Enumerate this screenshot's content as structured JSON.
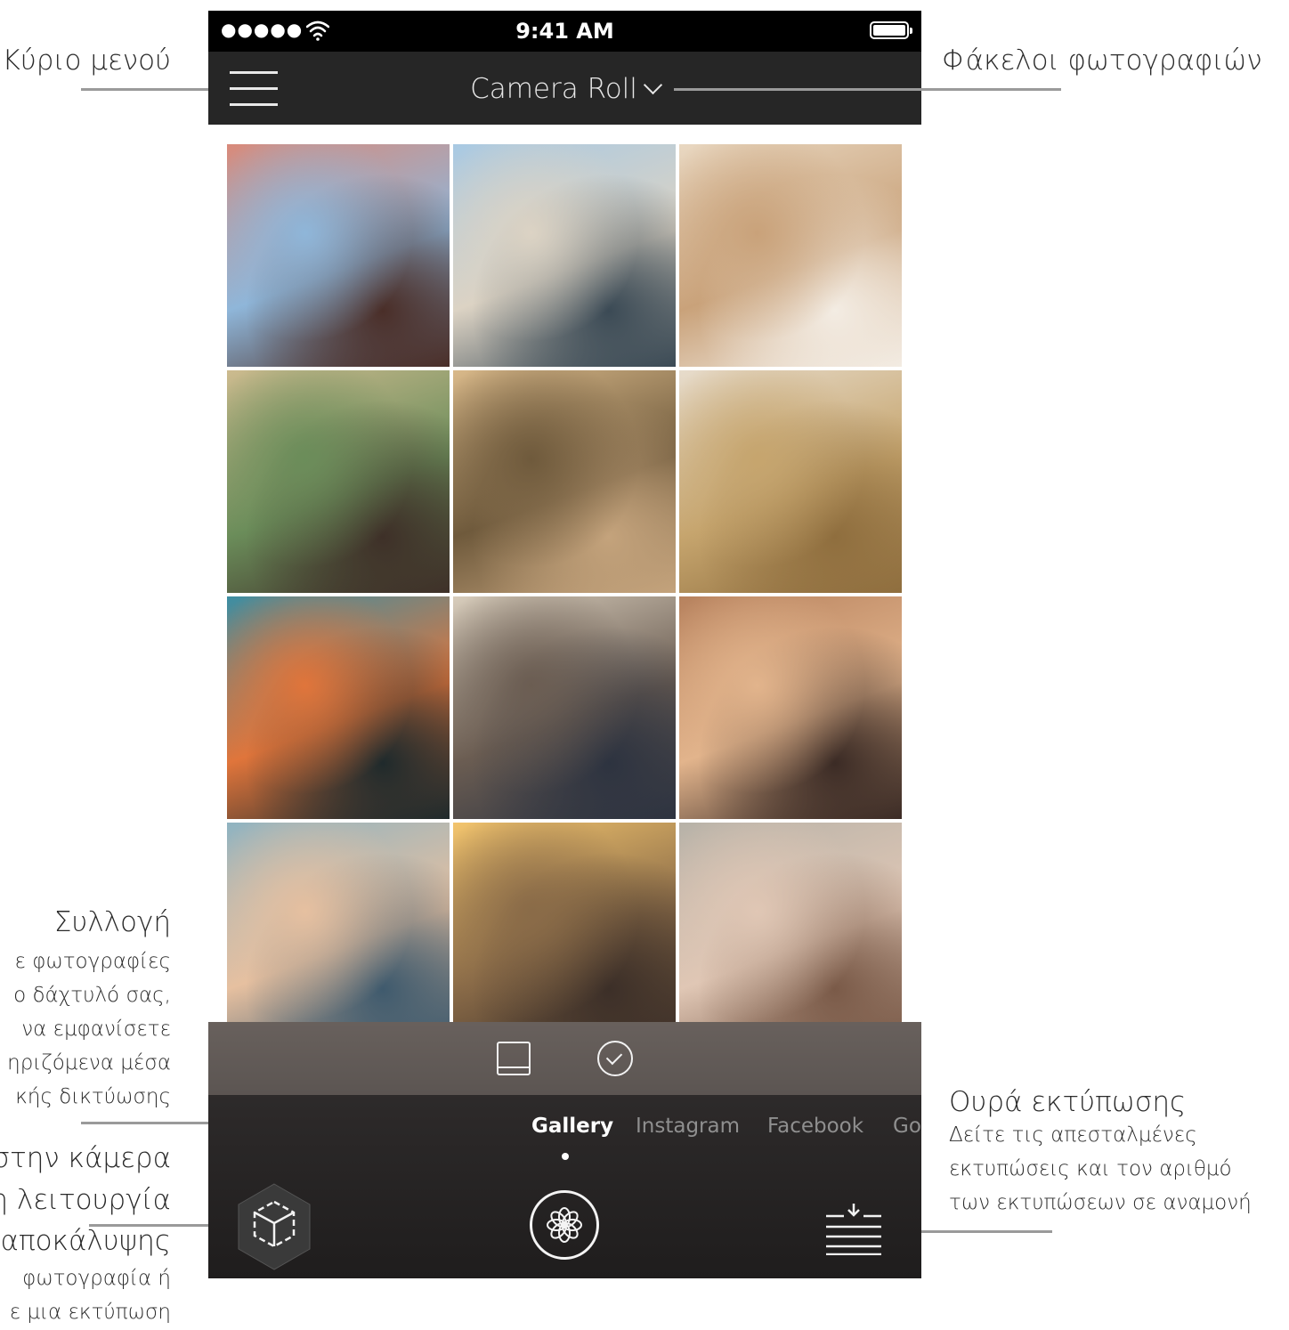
{
  "callouts": {
    "main_menu": "Κύριο μενού",
    "photo_folders": "Φάκελοι φωτογραφιών",
    "gallery_title": "Συλλογή",
    "gallery_body": [
      "ε φωτογραφίες",
      "ο δάχτυλό σας,",
      "να εμφανίσετε",
      "ηριζόμενα μέσα",
      "κής δικτύωσης"
    ],
    "camera_reveal_title": [
      "στην κάμερα",
      "η λειτουργία",
      "αποκάλυψης"
    ],
    "camera_reveal_body": [
      "φωτογραφία ή",
      "ε μια εκτύπωση"
    ],
    "print_queue_title": "Ουρά εκτύπωσης",
    "print_queue_body": [
      "Δείτε τις απεσταλμένες",
      "εκτυπώσεις και τον αριθμό",
      "των εκτυπώσεων σε αναμονή"
    ]
  },
  "status_bar": {
    "signal": "●●●●●",
    "time": "9:41 AM"
  },
  "nav": {
    "album_title": "Camera Roll"
  },
  "photos": [
    {
      "id": "friends-circle",
      "colors": [
        "#d98a7a",
        "#8fb6d9",
        "#4a2e28"
      ]
    },
    {
      "id": "skateboarder",
      "colors": [
        "#a8c9e3",
        "#dcd3c4",
        "#3b4a55"
      ]
    },
    {
      "id": "kitten",
      "colors": [
        "#e9d8c2",
        "#c9a27a",
        "#f3ece3"
      ]
    },
    {
      "id": "festival-crowd",
      "colors": [
        "#cdbb8f",
        "#6b8d5a",
        "#3e3028"
      ]
    },
    {
      "id": "car-friends",
      "colors": [
        "#d9b98a",
        "#6f5a3c",
        "#c4a37c"
      ]
    },
    {
      "id": "wheat-field",
      "colors": [
        "#e7dccc",
        "#c6a56e",
        "#8f6e3e"
      ]
    },
    {
      "id": "palm-sunset",
      "colors": [
        "#3c8ea3",
        "#e0753b",
        "#1f2a2c"
      ]
    },
    {
      "id": "girl-glasses",
      "colors": [
        "#d8cdbc",
        "#6b5d52",
        "#2d3340"
      ]
    },
    {
      "id": "concert-hands",
      "colors": [
        "#b7825e",
        "#e2b48c",
        "#3b2b25"
      ]
    },
    {
      "id": "piggyback",
      "colors": [
        "#8fb3c1",
        "#e6c0a0",
        "#3f5a6d"
      ]
    },
    {
      "id": "pier-couple",
      "colors": [
        "#f3c56e",
        "#8a6b48",
        "#3c2f28"
      ]
    },
    {
      "id": "shopping-street",
      "colors": [
        "#b7b2a8",
        "#e0c7b5",
        "#7a5a48"
      ]
    }
  ],
  "source_tabs": [
    "Gallery",
    "Instagram",
    "Facebook",
    "Goo"
  ],
  "active_source": "Gallery",
  "colors": {
    "status_bar": "#000000",
    "nav_bar": "#262626",
    "leader": "#9a9a9a"
  },
  "icons": {
    "menu": "hamburger-icon",
    "album_dropdown": "chevron-down-icon",
    "single_view": "single-view-icon",
    "select": "check-circle-icon",
    "reveal": "cube-icon",
    "capture": "flower-shutter-icon",
    "print_queue": "print-queue-icon"
  }
}
